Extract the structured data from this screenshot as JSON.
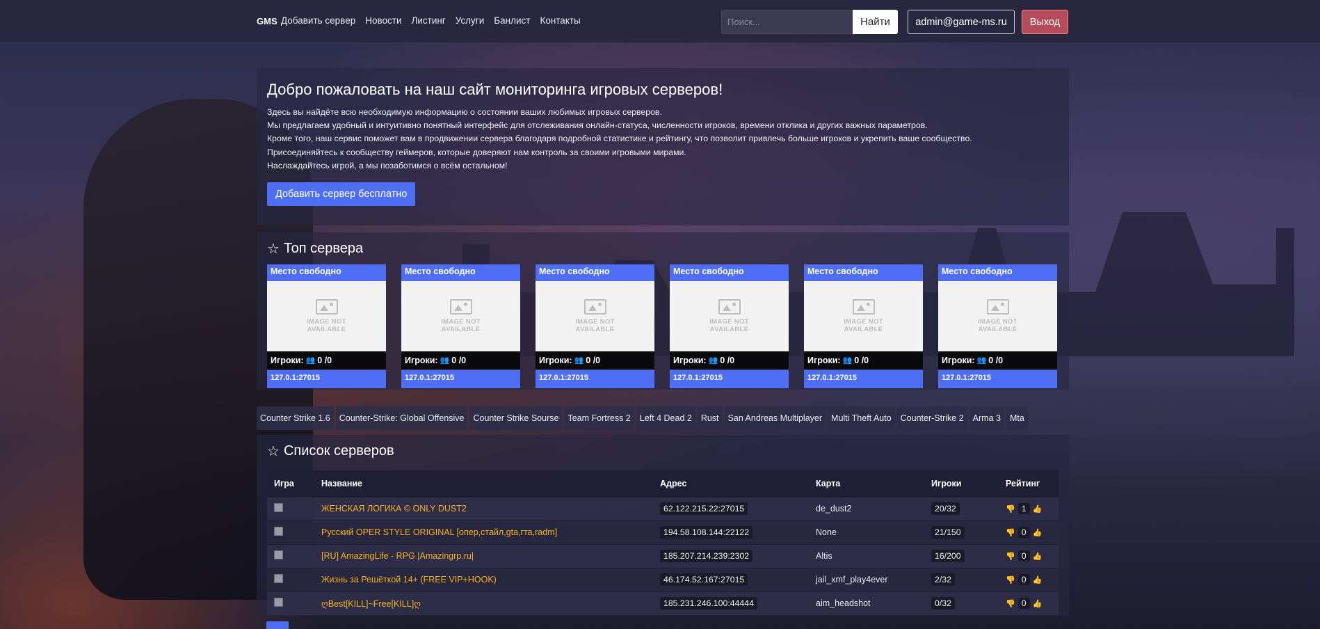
{
  "nav": {
    "brand": "GMS",
    "links": [
      "Добавить сервер",
      "Новости",
      "Листинг",
      "Услуги",
      "Банлист",
      "Контакты"
    ],
    "search_placeholder": "Поиск...",
    "search_button": "Найти",
    "user": "admin@game-ms.ru",
    "logout": "Выход"
  },
  "hero": {
    "title": "Добро пожаловать на наш сайт мониторинга игровых серверов!",
    "lines": [
      "Здесь вы найдёте всю необходимую информацию о состоянии ваших любимых игровых серверов.",
      "Мы предлагаем удобный и интуитивно понятный интерфейс для отслеживания онлайн-статуса, численности игроков, времени отклика и других важных параметров.",
      "Кроме того, наш сервис поможет вам в продвижении сервера благодаря подробной статистике и рейтингу, что позволит привлечь больше игроков и укрепить ваше сообщество.",
      "Присоединяйтесь к сообществу геймеров, которые доверяют нам контроль за своими игровыми мирами.",
      "Наслаждайтесь игрой, а мы позаботимся о всём остальном!"
    ],
    "cta": "Добавить сервер бесплатно"
  },
  "top": {
    "title": "Топ сервера",
    "image_placeholder_line1": "IMAGE NOT",
    "image_placeholder_line2": "AVAILABLE",
    "cards": [
      {
        "label": "Место свободно",
        "players_label": "Игроки:",
        "players": "0 /0",
        "address": "127.0.1:27015"
      },
      {
        "label": "Место свободно",
        "players_label": "Игроки:",
        "players": "0 /0",
        "address": "127.0.1:27015"
      },
      {
        "label": "Место свободно",
        "players_label": "Игроки:",
        "players": "0 /0",
        "address": "127.0.1:27015"
      },
      {
        "label": "Место свободно",
        "players_label": "Игроки:",
        "players": "0 /0",
        "address": "127.0.1:27015"
      },
      {
        "label": "Место свободно",
        "players_label": "Игроки:",
        "players": "0 /0",
        "address": "127.0.1:27015"
      },
      {
        "label": "Место свободно",
        "players_label": "Игроки:",
        "players": "0 /0",
        "address": "127.0.1:27015"
      }
    ]
  },
  "game_tabs": [
    "Counter Strike 1.6",
    "Counter-Strike: Global Offensive",
    "Counter Strike Sourse",
    "Team Fortress 2",
    "Left 4 Dead 2",
    "Rust",
    "San Andreas Multiplayer",
    "Multi Theft Auto",
    "Counter-Strike 2",
    "Arma 3",
    "Mta"
  ],
  "list": {
    "title": "Список серверов",
    "columns": [
      "Игра",
      "Название",
      "Адрес",
      "Карта",
      "Игроки",
      "Рейтинг"
    ],
    "rows": [
      {
        "game_icon": "cs16-icon",
        "name": "ЖЕНСКАЯ ЛОГИКА © ONLY DUST2",
        "address": "62.122.215.22:27015",
        "map": "de_dust2",
        "players": "20/32",
        "rating": "1"
      },
      {
        "game_icon": "samp-icon",
        "name": "Русский OPER STYLE ORIGINAL [опер,стайл,gta,гта,radm]",
        "address": "194.58.108.144:22122",
        "map": "None",
        "players": "21/150",
        "rating": "0"
      },
      {
        "game_icon": "arma-icon",
        "name": "[RU] AmazingLife - RPG |Amazingrp.ru|",
        "address": "185.207.214.239:2302",
        "map": "Altis",
        "players": "16/200",
        "rating": "0"
      },
      {
        "game_icon": "cs16-icon",
        "name": "Жизнь за Решёткой 14+ (FREE VIP+HOOK)",
        "address": "46.174.52.167:27015",
        "map": "jail_xmf_play4ever",
        "players": "2/32",
        "rating": "0"
      },
      {
        "game_icon": "cs16-icon",
        "name": "ღBest[KILL]~Free[KILL]ღ",
        "address": "185.231.246.100:44444",
        "map": "aim_headshot",
        "players": "0/32",
        "rating": "0"
      }
    ]
  }
}
